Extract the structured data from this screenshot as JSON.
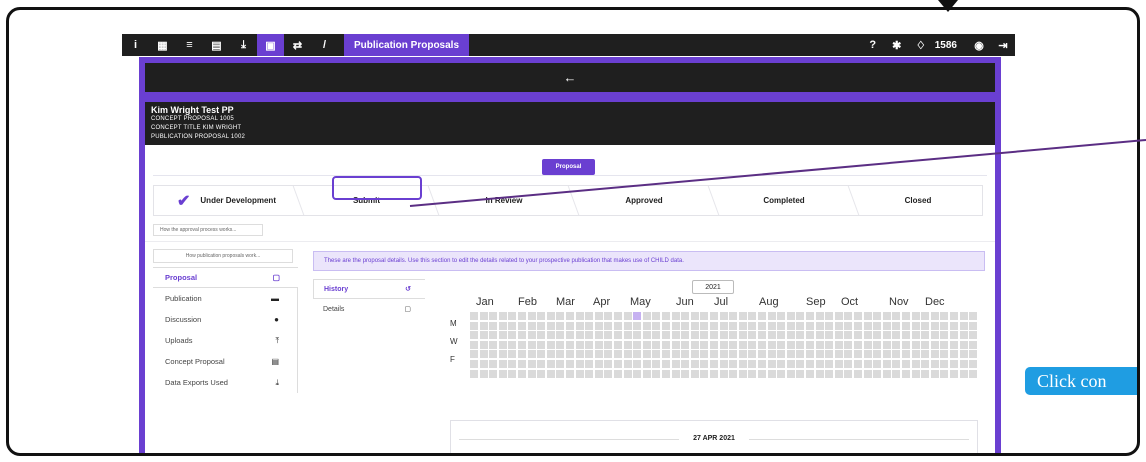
{
  "topnav": {
    "icons_left": [
      "info-icon",
      "grid-icon",
      "database-icon",
      "document-icon",
      "download-icon",
      "proposal-icon",
      "transfer-icon",
      "slash-icon"
    ],
    "title": "Publication Proposals",
    "icons_right": [
      "help-icon",
      "bug-icon",
      "bell-icon",
      "user-icon",
      "logout-icon"
    ],
    "notifications": "1586"
  },
  "back_label": "←",
  "header": {
    "title": "Kim Wright Test PP",
    "line1": "CONCEPT PROPOSAL 1005",
    "line2": "CONCEPT TITLE KIM WRIGHT",
    "line3": "PUBLICATION PROPOSAL 1002"
  },
  "proposal_tab": "Proposal",
  "steps": {
    "under_development": "Under Development",
    "submit": "Submit",
    "in_review": "In Review",
    "approved": "Approved",
    "completed": "Completed",
    "closed": "Closed"
  },
  "approval_help": "How the approval process works...",
  "publication_help": "How publication proposals work...",
  "left_nav": [
    {
      "label": "Proposal",
      "icon": "file-icon"
    },
    {
      "label": "Publication",
      "icon": "book-icon"
    },
    {
      "label": "Discussion",
      "icon": "comment-icon"
    },
    {
      "label": "Uploads",
      "icon": "upload-icon"
    },
    {
      "label": "Concept Proposal",
      "icon": "document-icon"
    },
    {
      "label": "Data Exports Used",
      "icon": "download-icon"
    }
  ],
  "info_text": "These are the proposal details. Use this section to edit the details related to your prospective publication that makes use of CHILD data.",
  "sub_tabs": [
    {
      "label": "History",
      "icon": "history-icon"
    },
    {
      "label": "Details",
      "icon": "file-icon"
    }
  ],
  "year": "2021",
  "months": [
    "Jan",
    "Feb",
    "Mar",
    "Apr",
    "May",
    "Jun",
    "Jul",
    "Aug",
    "Sep",
    "Oct",
    "Nov",
    "Dec"
  ],
  "day_labels": [
    "M",
    "W",
    "F"
  ],
  "history_date": "27 APR 2021",
  "callout_text": "Click con",
  "colors": {
    "accent": "#6a3fd1",
    "dark": "#1f1f1f",
    "callout": "#1f9de2",
    "heat_on": "#c6b1f1",
    "heat_off": "#dadada"
  }
}
